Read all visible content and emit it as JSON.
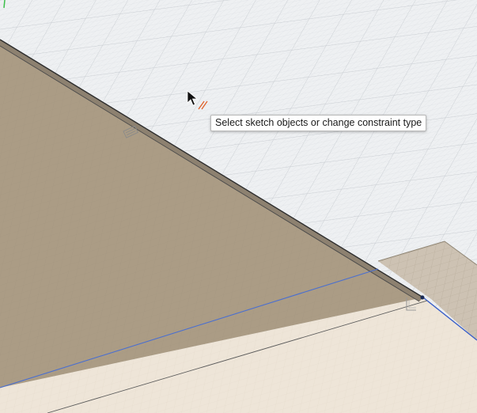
{
  "app": {
    "context": "sketch-constraint-mode"
  },
  "tooltip": {
    "text": "Select sketch objects or change constraint type"
  },
  "cursor": {
    "icon": "arrow-pointer-icon",
    "badge_icon": "parallel-constraint-icon",
    "badge_color": "#e0612a"
  },
  "colors": {
    "grid_background": "#eef0f2",
    "grid_minor": "#dcdfe3",
    "grid_major": "#c9cdd2",
    "sketch_plane": "#ab9c85",
    "lower_face": "#eee5d8",
    "profile_edge": "#3a3a3a",
    "highlight_edge": "#4a6fd0",
    "right_ledge": "#cdc2b3",
    "constraint_glyph": "#8a8a8a"
  },
  "constraints": [
    {
      "icon": "parallel-constraint-glyph-icon"
    },
    {
      "icon": "perpendicular-constraint-glyph-icon"
    },
    {
      "icon": "green-axis-icon"
    }
  ]
}
